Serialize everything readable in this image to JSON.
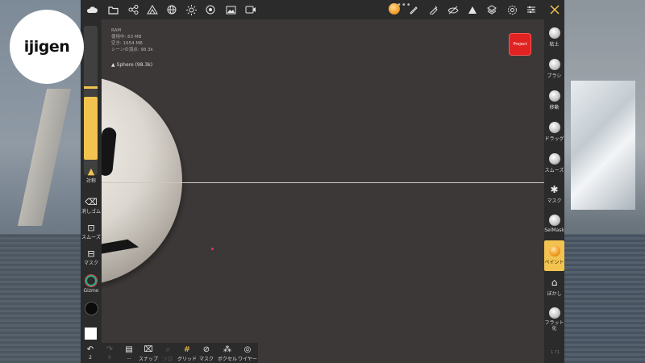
{
  "logo": {
    "text": "ijigen"
  },
  "topbar": {
    "dots": "•••",
    "icons_left": [
      "cloud-icon",
      "folder-icon",
      "share-icon",
      "mesh-icon",
      "globe-icon",
      "sun-icon",
      "material-icon",
      "image-icon",
      "video-icon"
    ],
    "icons_right": [
      "brush-icon",
      "eyedropper-icon",
      "hide-icon",
      "triangle-icon",
      "layers-icon",
      "settings-icon",
      "sliders-icon",
      "tools-icon"
    ]
  },
  "info": {
    "ram": "RAM",
    "used": "使用中: 63 MB",
    "free": "空き: 1654 MB",
    "vertices": "シーンの頂点: 98.3k"
  },
  "scene": {
    "object": "Sphere (98.3k)"
  },
  "project_button": "Project",
  "left_toolbar": {
    "symmetry": "対称",
    "eraser": "消しゴム",
    "smooth": "スムーズ",
    "mask": "マスク",
    "gizmo": "Gizmo"
  },
  "bottom_bar": {
    "undo_count": "2",
    "redo_count": "0",
    "snap": "スナップ",
    "solo": "ソロ",
    "grid": "グリッド",
    "mask": "マスク",
    "voxel": "ボクセル",
    "wire": "ワイヤー",
    "layer_count": "..."
  },
  "right_toolbar": {
    "tools": [
      "粘土",
      "ブラシ",
      "移動",
      "ドラッグ",
      "スムーズ",
      "マスク",
      "SelMask",
      "ペイント",
      "ぼかし"
    ],
    "flatten_1": "フラット",
    "flatten_2": "化",
    "active_tool": "ペイント"
  },
  "version": "1.71",
  "colors": {
    "accent": "#f2c34e",
    "project": "#e02222",
    "panel": "#2b2b2b",
    "viewport": "#3d3838"
  }
}
